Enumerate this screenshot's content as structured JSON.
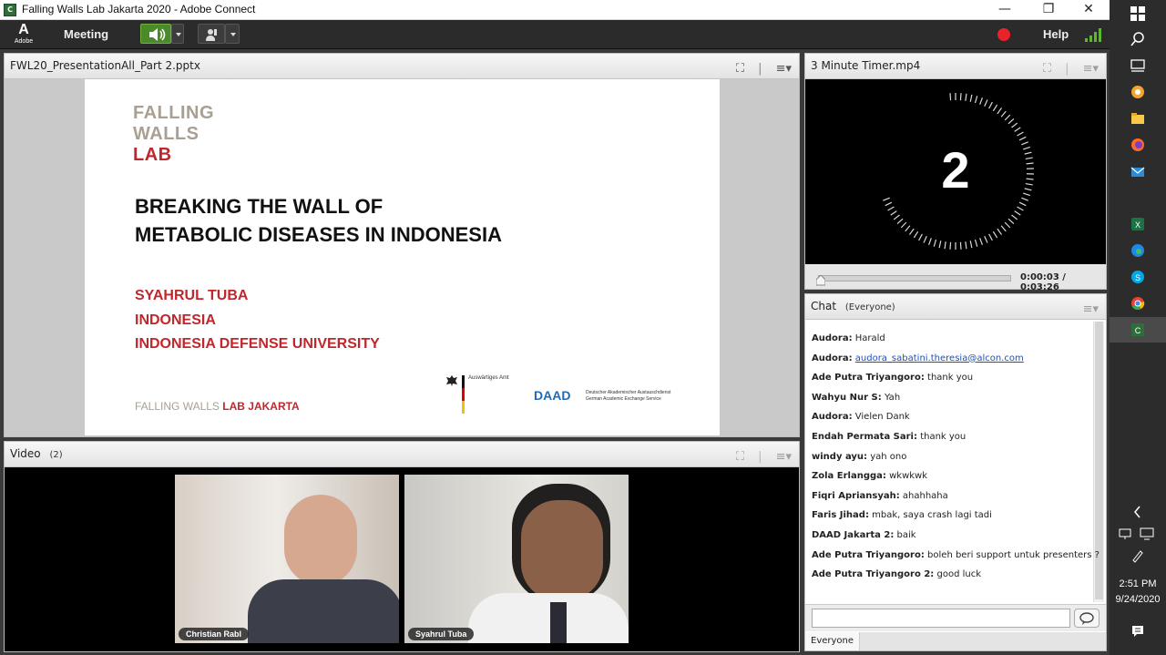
{
  "window": {
    "title": "Falling Walls Lab Jakarta 2020 - Adobe Connect",
    "minimize": "—",
    "restore": "❐",
    "close": "✕"
  },
  "menubar": {
    "logo_letter": "A",
    "logo_word": "Adobe",
    "meeting_label": "Meeting",
    "help_label": "Help",
    "record_color": "#e8232a",
    "signal_color": "#5cb82d"
  },
  "share_pod": {
    "title": "FWL20_PresentationAll_Part 2.pptx",
    "slide": {
      "logo_line1": "FALLING",
      "logo_line2": "WALLS",
      "logo_line3": "LAB",
      "headline_line1": "BREAKING THE WALL OF",
      "headline_line2": "METABOLIC DISEASES IN INDONESIA",
      "presenter": "SYAHRUL TUBA",
      "country": "INDONESIA",
      "institution": "INDONESIA DEFENSE UNIVERSITY",
      "footer_grey": "FALLING WALLS",
      "footer_red": "LAB JAKARTA",
      "ministry": "Auswärtiges Amt",
      "daad": "DAAD",
      "daad_line1": "Deutscher Akademischer Austauschdienst",
      "daad_line2": "German Academic Exchange Service"
    }
  },
  "timer_pod": {
    "title": "3 Minute Timer.mp4",
    "count": "2",
    "time_current": "0:00:03",
    "time_separator": "/",
    "time_total": "0:03:26",
    "progress": 0.015
  },
  "chat_pod": {
    "title": "Chat",
    "scope": "(Everyone)",
    "messages": [
      {
        "sender": "Audora:",
        "text": "Harald"
      },
      {
        "sender": "Audora:",
        "text": "audora_sabatini.theresia@alcon.com",
        "link": true
      },
      {
        "sender": "Ade Putra Triyangoro:",
        "text": "thank you"
      },
      {
        "sender": "Wahyu Nur S:",
        "text": "Yah"
      },
      {
        "sender": "Audora:",
        "text": "Vielen Dank"
      },
      {
        "sender": "Endah Permata Sari:",
        "text": "thank you"
      },
      {
        "sender": "windy ayu:",
        "text": "yah ono"
      },
      {
        "sender": "Zola Erlangga:",
        "text": "wkwkwk"
      },
      {
        "sender": "Fiqri Apriansyah:",
        "text": "ahahhaha"
      },
      {
        "sender": "Faris Jihad:",
        "text": "mbak, saya crash lagi tadi"
      },
      {
        "sender": "DAAD Jakarta 2:",
        "text": "baik"
      },
      {
        "sender": "Ade Putra Triyangoro:",
        "text": "boleh beri support untuk presenters ?"
      },
      {
        "sender": "Ade Putra Triyangoro 2:",
        "text": "good luck"
      }
    ],
    "input_placeholder": "",
    "audience_tab": "Everyone"
  },
  "video_pod": {
    "title": "Video",
    "count": "(2)",
    "participants": [
      {
        "name": "Christian Rabl"
      },
      {
        "name": "Syahrul Tuba"
      }
    ]
  },
  "taskbar": {
    "time": "2:51 PM",
    "date": "9/24/2020"
  }
}
